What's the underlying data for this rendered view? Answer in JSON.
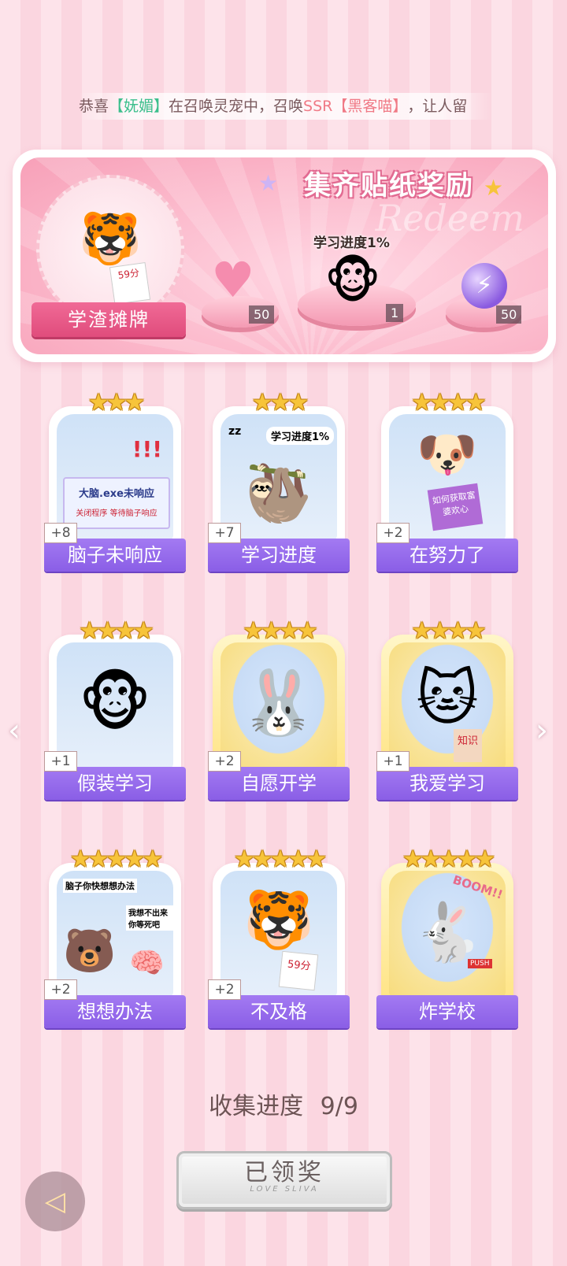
{
  "marquee": {
    "prefix": "恭喜",
    "user": "【妩媚】",
    "middle": "在召唤灵宠中，召唤",
    "rarity": "SSR",
    "pet": "【黑客喵】",
    "suffix": "，让人留"
  },
  "reward_panel": {
    "title": "集齐贴纸奖励",
    "watermark": "Redeem",
    "badge_label": "学渣摊牌",
    "avatar_note": "59分",
    "progress_caption": "学习进度1%",
    "items": [
      {
        "icon": "heart-gem-icon",
        "count": "50"
      },
      {
        "icon": "monkey-phone-icon",
        "count": "1"
      },
      {
        "icon": "lightning-orb-icon",
        "count": "50"
      }
    ]
  },
  "cards": [
    {
      "name": "脑子未响应",
      "count": "+8",
      "stars": "★★★",
      "gold": false,
      "art_text": "大脑.exe未响应",
      "art_sub": "关闭程序  等待脑子响应"
    },
    {
      "name": "学习进度",
      "count": "+7",
      "stars": "★★★",
      "gold": false,
      "art_text": "学习进度1%",
      "art_sub": "zz"
    },
    {
      "name": "在努力了",
      "count": "+2",
      "stars": "★★★★",
      "gold": false,
      "art_text": "如何获取富婆欢心",
      "art_sub": ""
    },
    {
      "name": "假装学习",
      "count": "+1",
      "stars": "★★★★",
      "gold": false,
      "art_text": "",
      "art_sub": ""
    },
    {
      "name": "自愿开学",
      "count": "+2",
      "stars": "★★★★",
      "gold": true,
      "art_text": "",
      "art_sub": ""
    },
    {
      "name": "我爱学习",
      "count": "+1",
      "stars": "★★★★",
      "gold": true,
      "art_text": "知识",
      "art_sub": ""
    },
    {
      "name": "想想办法",
      "count": "+2",
      "stars": "★★★★★",
      "gold": false,
      "art_text": "脑子你快想想办法",
      "art_sub": "我想不出来 你等死吧"
    },
    {
      "name": "不及格",
      "count": "+2",
      "stars": "★★★★★",
      "gold": false,
      "art_text": "59分",
      "art_sub": ""
    },
    {
      "name": "炸学校",
      "count": "",
      "stars": "★★★★★",
      "gold": true,
      "art_text": "BOOM!!",
      "art_sub": "PUSH"
    }
  ],
  "collection": {
    "label": "收集进度",
    "value": "9/9"
  },
  "claim_button": {
    "label": "已领奖",
    "sub": "LOVE SLIVA"
  },
  "nav": {
    "left_arrow": "‹",
    "right_arrow": "›",
    "back_icon": "◁"
  }
}
